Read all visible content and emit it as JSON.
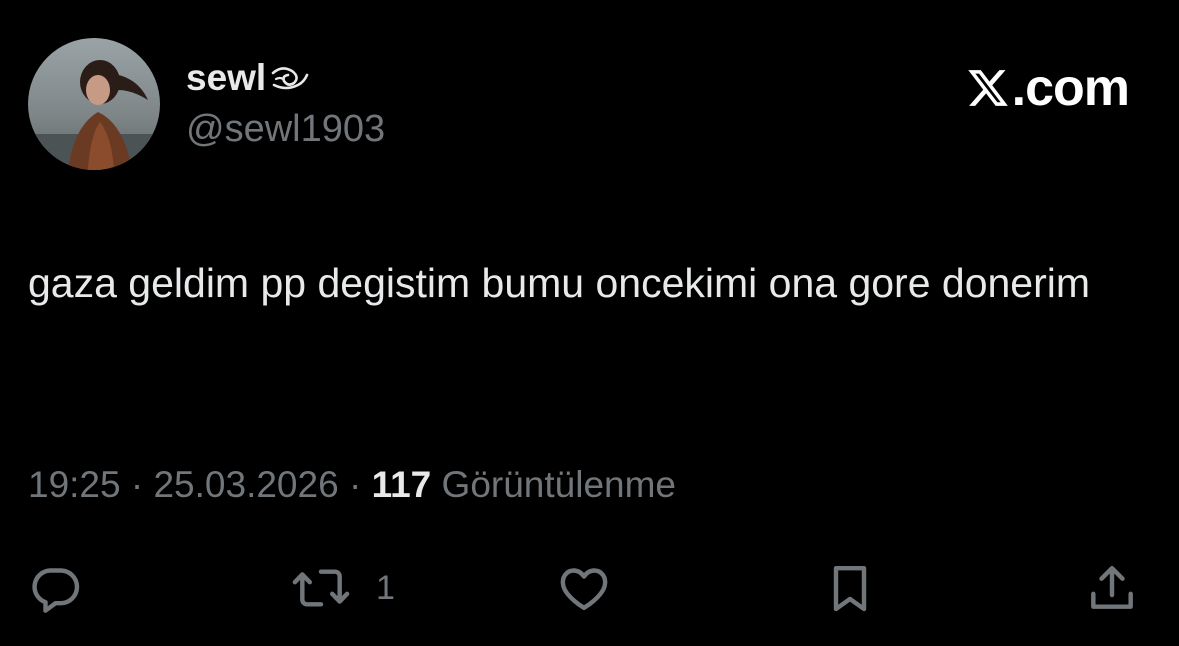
{
  "author": {
    "display_name": "sewl",
    "handle": "@sewl1903",
    "emoji_icon": "wave-swirl-emoji-icon",
    "avatar": "profile-photo-avatar"
  },
  "brand": {
    "text": ".com",
    "icon": "x-logo-icon"
  },
  "tweet": {
    "text": "gaza geldim pp degistim bumu oncekimi ona gore donerim",
    "time": "19:25",
    "date": "25.03.2026",
    "separator": "·",
    "views_count": "117",
    "views_label": "Görüntülenme"
  },
  "actions": {
    "reply": {
      "icon": "reply-icon",
      "count": ""
    },
    "retweet": {
      "icon": "retweet-icon",
      "count": "1"
    },
    "like": {
      "icon": "heart-icon",
      "count": ""
    },
    "bookmark": {
      "icon": "bookmark-icon",
      "count": ""
    },
    "share": {
      "icon": "share-icon",
      "count": ""
    }
  },
  "colors": {
    "background": "#000000",
    "primary_text": "#e7e9ea",
    "secondary_text": "#71767b"
  }
}
